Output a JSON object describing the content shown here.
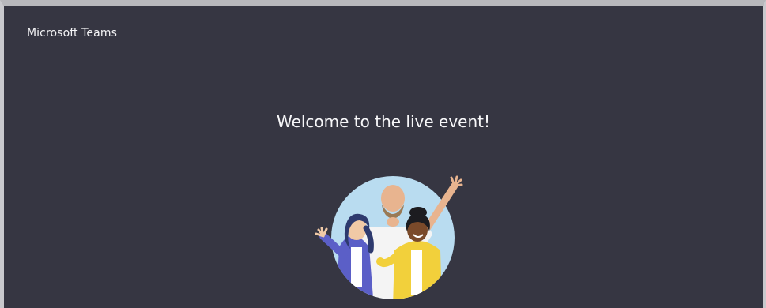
{
  "window": {
    "app_title": "Microsoft Teams"
  },
  "main": {
    "welcome_text": "Welcome to the live event!",
    "illustration_icon": "people-waving-illustration"
  },
  "colors": {
    "background": "#363642",
    "text": "#ffffff",
    "illustration_circle": "#b9dcf0"
  }
}
